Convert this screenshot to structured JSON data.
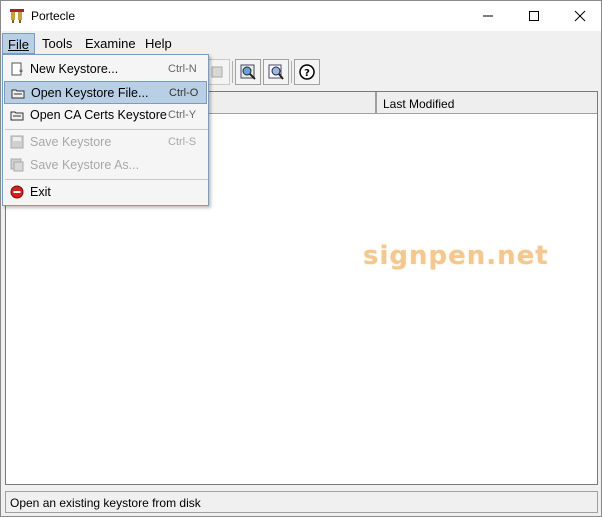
{
  "window": {
    "title": "Portecle",
    "icon": "portecle-app-icon",
    "controls": [
      "minimize",
      "maximize",
      "close"
    ]
  },
  "menubar": {
    "file": "File",
    "tools": "Tools",
    "examine": "Examine",
    "help": "Help",
    "active": "File"
  },
  "toolbar": {
    "buttons": [
      "new-keystore-icon",
      "open-keystore-icon",
      "save-keystore-icon",
      "examine-certificate-icon",
      "examine-crl-icon",
      "help-icon"
    ]
  },
  "table": {
    "columns": [
      "",
      "Last Modified"
    ],
    "rows": []
  },
  "file_menu": {
    "items": [
      {
        "label": "New Keystore...",
        "accel": "Ctrl-N",
        "icon": "new-keystore-icon",
        "enabled": true
      },
      {
        "label": "Open Keystore File...",
        "accel": "Ctrl-O",
        "icon": "open-keystore-icon",
        "enabled": true,
        "highlighted": true
      },
      {
        "label": "Open CA Certs Keystore",
        "accel": "Ctrl-Y",
        "icon": "open-cacerts-icon",
        "enabled": true
      },
      {
        "label": "Save Keystore",
        "accel": "Ctrl-S",
        "icon": "save-icon",
        "enabled": false
      },
      {
        "label": "Save Keystore As...",
        "accel": "",
        "icon": "save-as-icon",
        "enabled": false
      },
      {
        "label": "Exit",
        "accel": "",
        "icon": "exit-icon",
        "enabled": true
      }
    ]
  },
  "watermark": "signpen.net",
  "status": {
    "text": "Open an existing keystore from disk"
  },
  "colors": {
    "highlight": "#b8cfe5",
    "highlight_border": "#7a9cc0",
    "watermark": "#f2c890",
    "exit_red": "#d32020"
  }
}
